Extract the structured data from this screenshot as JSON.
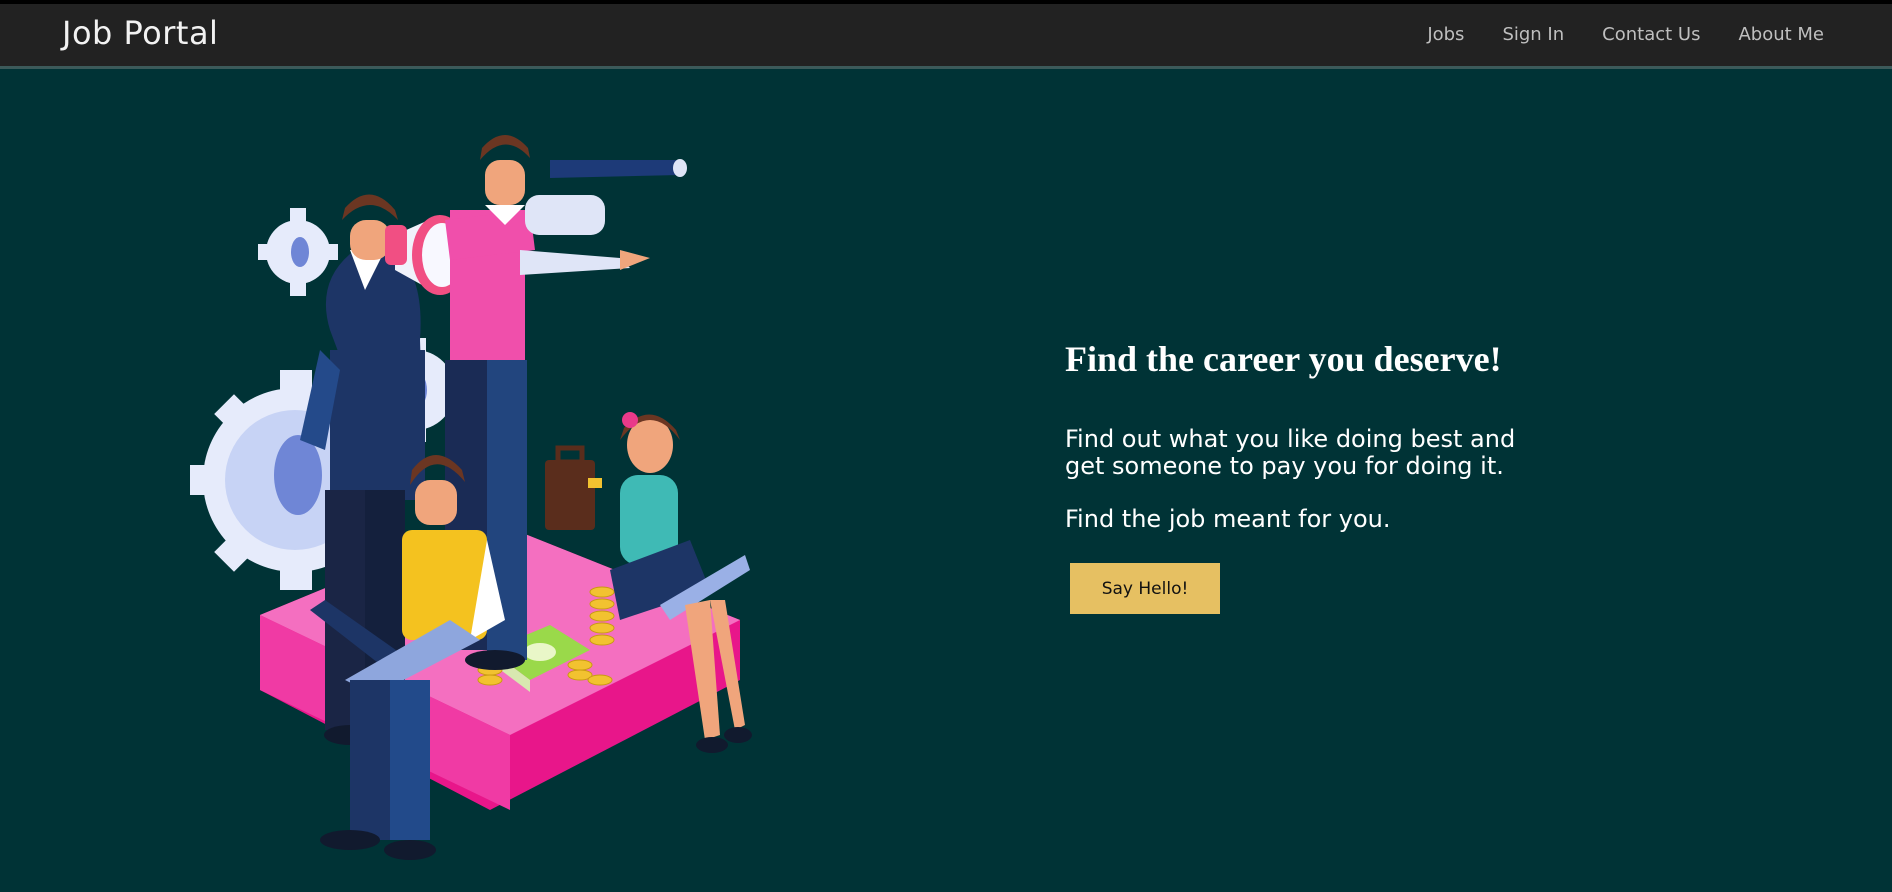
{
  "header": {
    "brand": "Job Portal",
    "nav": [
      {
        "label": "Jobs"
      },
      {
        "label": "Sign In"
      },
      {
        "label": "Contact Us"
      },
      {
        "label": "About Me"
      }
    ]
  },
  "hero": {
    "headline": "Find the career you deserve!",
    "paragraph_1": "Find out what you like doing best and get someone to pay you for doing it.",
    "paragraph_2": "Find the job meant for you.",
    "cta_label": "Say Hello!",
    "illustration": "team-career-illustration"
  },
  "colors": {
    "background": "#003336",
    "header": "#222222",
    "cta": "#e6c062",
    "accent_pink": "#f14fa8"
  }
}
